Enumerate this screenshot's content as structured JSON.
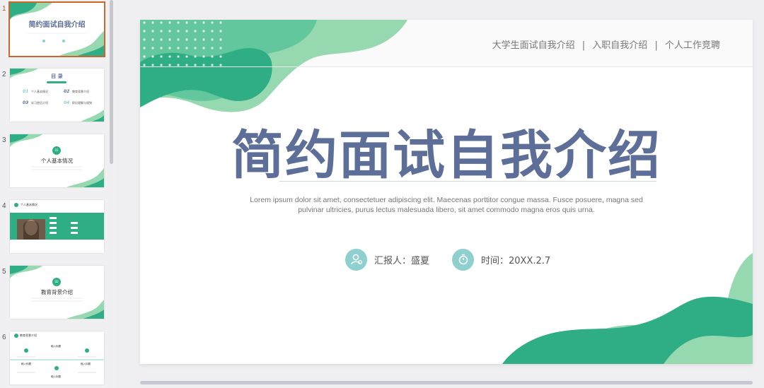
{
  "slides_panel": {
    "items": [
      {
        "number": "1",
        "title": "简约面试自我介绍",
        "active": true
      },
      {
        "number": "2",
        "title": "目 录",
        "entries": [
          {
            "num": "01",
            "label": "个人基本情况"
          },
          {
            "num": "02",
            "label": "教育背景介绍"
          },
          {
            "num": "03",
            "label": "实习经历介绍"
          },
          {
            "num": "04",
            "label": "职位理解与规划"
          }
        ]
      },
      {
        "number": "3",
        "badge": "01",
        "title": "个人基本情况"
      },
      {
        "number": "4",
        "title": "个人基本情况"
      },
      {
        "number": "5",
        "badge": "02",
        "title": "教育背景介绍"
      },
      {
        "number": "6",
        "title": "教育背景介绍",
        "labels": [
          "输入标题",
          "输入标题",
          "输入标题",
          "输入标题"
        ]
      }
    ]
  },
  "slide": {
    "nav": [
      "大学生面试自我介绍",
      "入职自我介绍",
      "个人工作竞聘"
    ],
    "nav_separator": "|",
    "title": "简约面试自我介绍",
    "description": "Lorem ipsum dolor sit amet, consectetuer adipiscing elit. Maecenas porttitor congue massa. Fusce posuere, magna sed pulvinar ultricies, purus lectus malesuada libero, sit amet commodo magna eros quis urna.",
    "reporter": "汇报人：盛夏",
    "time": "时间：20XX.2.7"
  },
  "colors": {
    "green_dark": "#2fae86",
    "green_mid": "#5cc49a",
    "green_light": "#96d9b0",
    "title": "#5d6f99",
    "icon_circle": "#8dd0cf",
    "active_outline": "#c8682a"
  },
  "icons": {
    "reporter": "user-icon",
    "time": "stopwatch-icon"
  }
}
